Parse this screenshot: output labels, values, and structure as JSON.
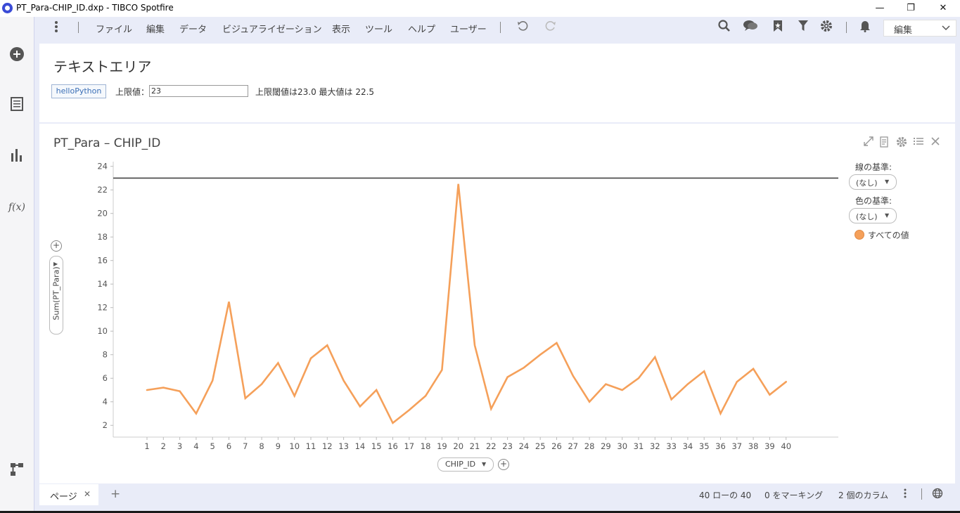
{
  "window": {
    "title": "PT_Para-CHIP_ID.dxp - TIBCO Spotfire",
    "minimize": "—",
    "restore": "❐",
    "close": "✕"
  },
  "menu": [
    "ファイル",
    "編集",
    "データ",
    "ビジュアライゼーション",
    "表示",
    "ツール",
    "ヘルプ",
    "ユーザー"
  ],
  "toolbar": {
    "mode_label": "編集"
  },
  "text_area": {
    "title": "テキストエリア",
    "button_label": "helloPython",
    "limit_label": "上限値：",
    "limit_value": "23",
    "status": "上限閾値は23.0 最大値は 22.5"
  },
  "viz": {
    "title": "PT_Para – CHIP_ID",
    "y_axis_label": "Sum(PT_Para)",
    "x_axis_label": "CHIP_ID",
    "legend": {
      "line_by_label": "線の基準:",
      "line_by_value": "(なし)",
      "color_by_label": "色の基準:",
      "color_by_value": "(なし)",
      "item_label": "すべての値",
      "item_color": "#f5a05a"
    }
  },
  "chart_data": {
    "type": "line",
    "x": [
      1,
      2,
      3,
      4,
      5,
      6,
      7,
      8,
      9,
      10,
      11,
      12,
      13,
      14,
      15,
      16,
      17,
      18,
      19,
      20,
      21,
      22,
      23,
      24,
      25,
      26,
      27,
      28,
      29,
      30,
      31,
      32,
      33,
      34,
      35,
      36,
      37,
      38,
      39,
      40
    ],
    "series": [
      {
        "values": [
          5.0,
          5.2,
          4.9,
          3.0,
          5.8,
          12.5,
          4.3,
          5.5,
          7.3,
          4.5,
          7.7,
          8.8,
          5.8,
          3.6,
          5.0,
          2.2,
          3.3,
          4.5,
          6.7,
          22.5,
          8.8,
          3.4,
          6.1,
          6.9,
          8.0,
          9.0,
          6.2,
          4.0,
          5.5,
          5.0,
          6.0,
          7.8,
          4.2,
          5.5,
          6.6,
          3.0,
          5.7,
          6.8,
          4.6,
          5.7
        ]
      }
    ],
    "reference_line": 23,
    "y_ticks": [
      2,
      4,
      6,
      8,
      10,
      12,
      14,
      16,
      18,
      20,
      22,
      24
    ],
    "ylim": [
      1,
      24.4
    ],
    "xlabel": "CHIP_ID",
    "ylabel": "Sum(PT_Para)",
    "line_color": "#f5a05a",
    "reference_color": "#444444",
    "grid": false,
    "legend_position": "right"
  },
  "statusbar": {
    "page_tab": "ページ",
    "add_page": "+",
    "rows": "40 ローの 40",
    "marking": "0 をマーキング",
    "columns": "2 個のカラム"
  }
}
